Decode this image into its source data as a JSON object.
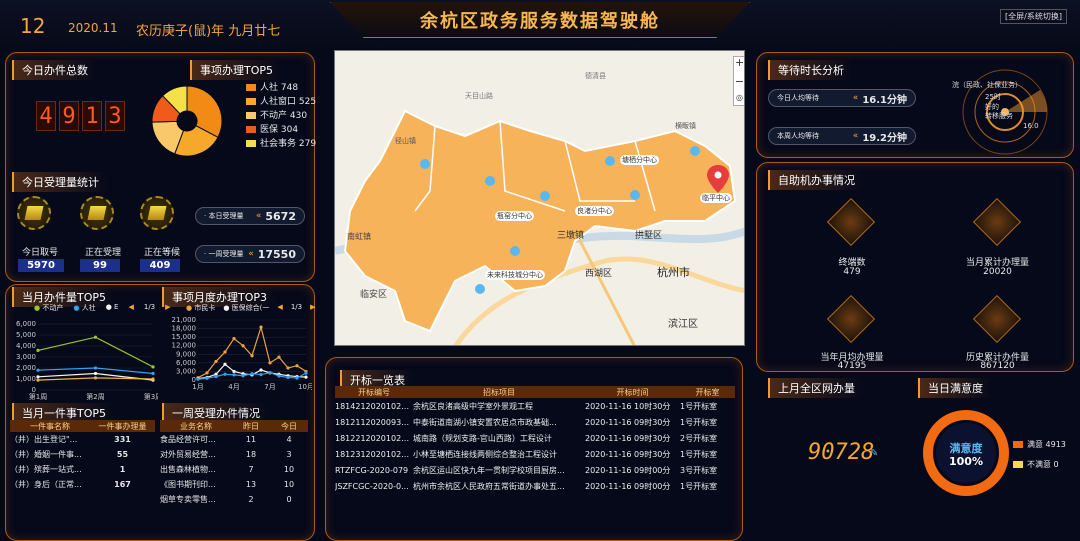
{
  "header": {
    "day": "12",
    "year_month": "2020.11",
    "lunar": "农历庚子(鼠)年 九月廿七",
    "title": "余杭区政务服务数据驾驶舱",
    "fullscreen_label": "[全屏/系统切换]"
  },
  "today_total": {
    "title": "今日办件总数",
    "digits": [
      "4",
      "9",
      "1",
      "3"
    ]
  },
  "top5": {
    "title": "事项办理TOP5",
    "items": [
      {
        "label": "人社 748",
        "value": 748,
        "color": "#f28a16"
      },
      {
        "label": "人社窗口 525",
        "value": 525,
        "color": "#f6a82a"
      },
      {
        "label": "不动产 430",
        "value": 430,
        "color": "#f9c86a"
      },
      {
        "label": "医保 304",
        "value": 304,
        "color": "#ef5b1a"
      },
      {
        "label": "社会事务 279",
        "value": 279,
        "color": "#f5e04a"
      }
    ]
  },
  "acceptance": {
    "title": "今日受理量统计",
    "items": [
      {
        "label": "今日取号",
        "value": "5970"
      },
      {
        "label": "正在受理",
        "value": "99"
      },
      {
        "label": "正在等候",
        "value": "409"
      }
    ],
    "today_label": "· 本日受理量",
    "today_value": "5672",
    "week_label": "· 一周受理量",
    "week_value": "17550"
  },
  "month_top5": {
    "title": "当月办件量TOP5",
    "legend": [
      "不动产",
      "人社",
      "E"
    ],
    "page": "1/3",
    "chart_data": {
      "type": "line",
      "categories": [
        "第1周",
        "第2周",
        "第3周"
      ],
      "ylim": [
        0,
        6000
      ],
      "yticks": [
        "6,000",
        "5,000",
        "4,000",
        "3,000",
        "2,000",
        "1,000",
        "0"
      ],
      "series": [
        {
          "name": "不动产",
          "values": [
            3600,
            4800,
            2100
          ],
          "color": "#9ac82a"
        },
        {
          "name": "人社",
          "values": [
            1800,
            2000,
            1500
          ],
          "color": "#2ea3f2"
        },
        {
          "name": "E",
          "values": [
            1200,
            1500,
            900
          ],
          "color": "#f6f6f6"
        },
        {
          "values": [
            900,
            1100,
            1000
          ],
          "color": "#f0b23a"
        }
      ]
    }
  },
  "month_trend": {
    "title": "事项月度办理TOP3",
    "legend": [
      "市民卡",
      "医保综合(一"
    ],
    "page": "1/3",
    "chart_data": {
      "type": "line",
      "categories": [
        "1月",
        "4月",
        "7月",
        "10月"
      ],
      "ylim": [
        0,
        21000
      ],
      "yticks": [
        "21,000",
        "18,000",
        "15,000",
        "12,000",
        "9,000",
        "6,000",
        "3,000",
        "0"
      ],
      "series": [
        {
          "name": "市民卡",
          "values": [
            800,
            2500,
            6500,
            9800,
            14500,
            12000,
            8500,
            18500,
            6000,
            8000,
            4200,
            5000,
            3000
          ],
          "color": "#f0a23a"
        },
        {
          "name": "医保综合(一",
          "values": [
            500,
            900,
            2000,
            5500,
            3000,
            2200,
            1800,
            3500,
            2500,
            2000,
            1500,
            1200,
            1000
          ],
          "color": "#f6f6f6"
        },
        {
          "values": [
            300,
            600,
            1200,
            2000,
            1800,
            1500,
            2200,
            1900,
            2600,
            1400,
            900,
            700,
            2400
          ],
          "color": "#2ea3f2"
        }
      ]
    }
  },
  "one_thing": {
    "title": "当月一件事TOP5",
    "headers": [
      "一件事名称",
      "一件事办理量"
    ],
    "rows": [
      {
        "name": "（井）出生登记\"...",
        "value": "331"
      },
      {
        "name": "（井）婚姻一件事...",
        "value": "55"
      },
      {
        "name": "（井）殡葬一站式...",
        "value": "1"
      },
      {
        "name": "（井）身后（正常...",
        "value": "167"
      }
    ]
  },
  "week_acceptance": {
    "title": "一周受理办件情况",
    "headers": [
      "业务名称",
      "昨日",
      "今日"
    ],
    "rows": [
      {
        "name": "食品经营许可...",
        "y": "11",
        "t": "4"
      },
      {
        "name": "对外贸易经营...",
        "y": "18",
        "t": "3"
      },
      {
        "name": "出售森林植物...",
        "y": "7",
        "t": "10"
      },
      {
        "name": "《图书期刊印...",
        "y": "13",
        "t": "10"
      },
      {
        "name": "烟草专卖零售...",
        "y": "2",
        "t": "0"
      }
    ]
  },
  "map": {
    "labels": [
      "径山镇",
      "瓶窑分中心",
      "良渚分中心",
      "塘栖分中心",
      "临平中心",
      "未来科技城分中心",
      "三墩镇",
      "拱墅区",
      "西湖区",
      "杭州市",
      "滨江区",
      "临安区",
      "南虹镇",
      "横畈镇",
      "天目山路",
      "德清县"
    ],
    "zoom_in": "+",
    "zoom_out": "−"
  },
  "bids": {
    "title": "开标一览表",
    "headers": [
      "开标编号",
      "招标项目",
      "开标时间",
      "开标室"
    ],
    "rows": [
      [
        "18142120201021...",
        "余杭区良渚高级中学室外景观工程",
        "2020-11-16 10时30分",
        "1号开标室"
      ],
      [
        "18121120200930...",
        "中泰街道南湖小镇安置农居点市政基础...",
        "2020-11-16 09时30分",
        "1号开标室"
      ],
      [
        "18122120201023...",
        "城南路（规划支路-官山西路）工程设计",
        "2020-11-16 09时30分",
        "2号开标室"
      ],
      [
        "18123120201021...",
        "小林至塘栖连接线两侧综合整治工程设计",
        "2020-11-16 09时30分",
        "1号开标室"
      ],
      [
        "RTZFCG-2020-079",
        "余杭区运山区快九年一贯制学校项目厨房...",
        "2020-11-16 09时00分",
        "3号开标室"
      ],
      [
        "JSZFCGC-2020-0...",
        "杭州市余杭区人民政府五常街道办事处五...",
        "2020-11-16 09时00分",
        "1号开标室"
      ]
    ]
  },
  "wait": {
    "title": "等待时长分析",
    "today_label": "今日人均等待",
    "today_value": "16.1分钟",
    "month_label": "本周人均等待",
    "month_value": "19.2分钟",
    "radar_labels": [
      "浣（民政、社保业务）",
      "25时",
      "好的",
      "转移服务",
      "16.0"
    ]
  },
  "self_service": {
    "title": "自助机办事情况",
    "items": [
      {
        "label": "终端数",
        "value": "479"
      },
      {
        "label": "当月累计办理量",
        "value": "20020"
      },
      {
        "label": "当年月均办理量",
        "value": "47195"
      },
      {
        "label": "历史累计办件量",
        "value": "867120"
      }
    ]
  },
  "network": {
    "title": "上月全区网办量",
    "value": "90728"
  },
  "satisfaction": {
    "title": "当日满意度",
    "label": "满意度",
    "percent": "100%",
    "legend": [
      {
        "label": "满意 4913",
        "color": "#f26a12"
      },
      {
        "label": "不满意 0",
        "color": "#f6d84a"
      }
    ]
  }
}
